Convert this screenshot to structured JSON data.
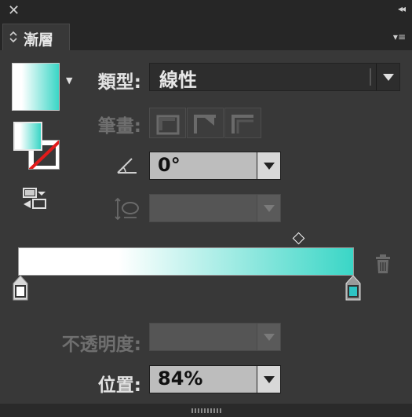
{
  "window": {
    "close_glyph": "✕",
    "collapse_glyph": "◂◂",
    "menu_glyph": "▾≡"
  },
  "tab": {
    "label": "漸層",
    "arrow_glyph": "◇"
  },
  "gradient": {
    "start_color": "#ffffff",
    "end_color": "#3ad6c6",
    "selected_stop_fill": "#2ec4c4",
    "midpoint_position": 0.84
  },
  "form": {
    "type_label": "類型:",
    "type_value": "線性",
    "stroke_label": "筆畫:",
    "angle_value": "0°",
    "aspect_value": "",
    "opacity_label": "不透明度:",
    "opacity_value": "",
    "position_label": "位置:",
    "position_value": "84%"
  },
  "colors": {
    "panel_bg": "#383838",
    "label_disabled": "#6f6f6f"
  }
}
